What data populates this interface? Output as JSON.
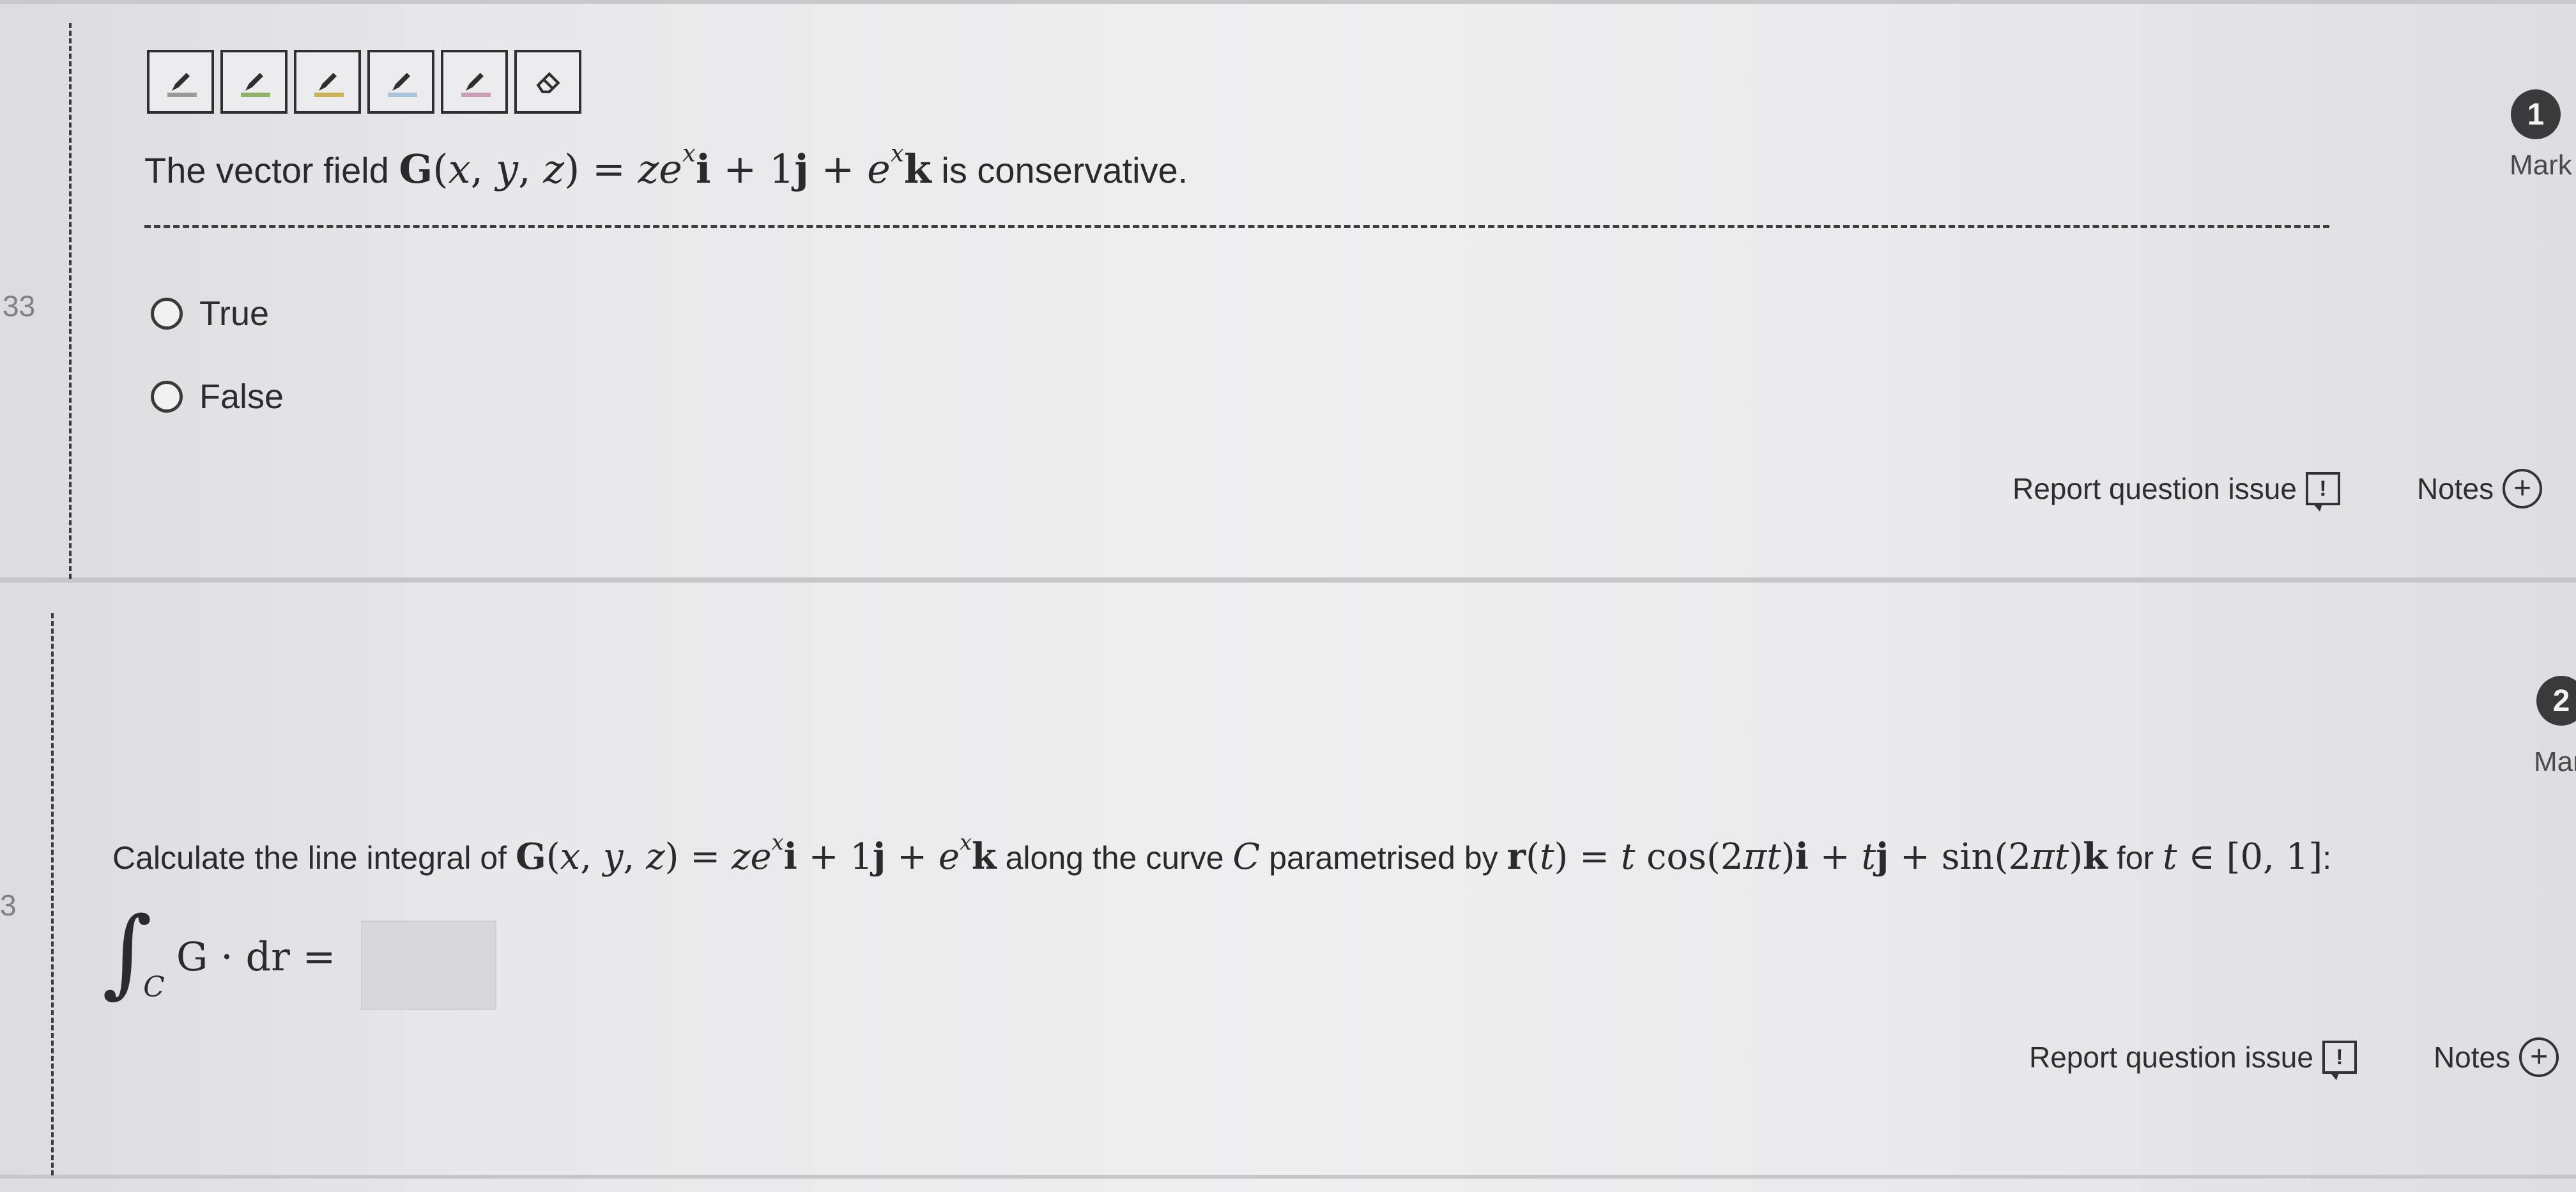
{
  "toolbar": {
    "tools": [
      {
        "icon": "pencil-icon",
        "color": "#9a9a9a"
      },
      {
        "icon": "pencil-icon",
        "color": "#8fb36a"
      },
      {
        "icon": "pencil-icon",
        "color": "#c9b35a"
      },
      {
        "icon": "pencil-icon",
        "color": "#a7c4d9"
      },
      {
        "icon": "pencil-icon",
        "color": "#c7a0b8"
      },
      {
        "icon": "eraser-icon",
        "color": "#2f2f32"
      }
    ]
  },
  "questions": [
    {
      "line_number": "33",
      "marks": "1",
      "marks_label": "Mark",
      "text_prefix": "The vector field",
      "text_suffix": "is conservative.",
      "options": [
        {
          "label": "True"
        },
        {
          "label": "False"
        }
      ],
      "report_label": "Report question issue",
      "notes_label": "Notes"
    },
    {
      "line_number": "3",
      "marks": "2",
      "marks_label": "Mar",
      "text_prefix": "Calculate the line integral of",
      "text_middle1": "along the curve",
      "text_middle2": "parametrised by",
      "text_middle3": "for",
      "text_end": ":",
      "integral_sub": "C",
      "integral_expr": "G · dr =",
      "report_label": "Report question issue",
      "notes_label": "Notes"
    }
  ],
  "colors": {
    "background": "#e6e6e7",
    "text": "#2b2b2e",
    "badge": "#3a3a3d"
  }
}
